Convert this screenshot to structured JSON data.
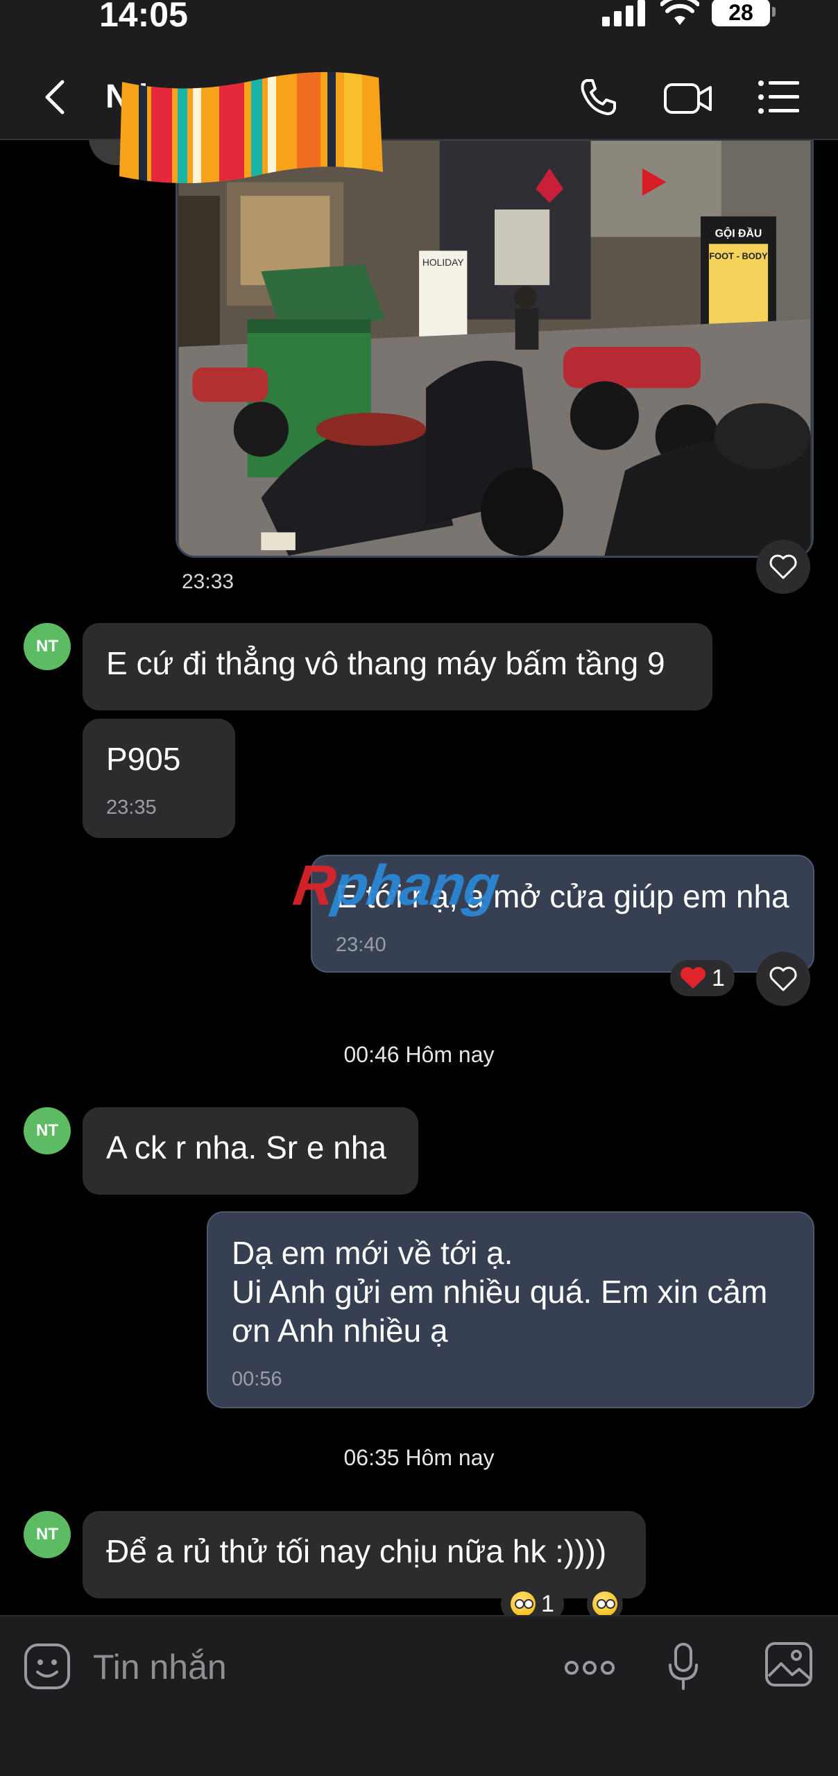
{
  "status_bar": {
    "time": "14:05",
    "battery": "28"
  },
  "header": {
    "contact_name": "N h"
  },
  "messages": {
    "photo_time": "23:33",
    "avatar_initials": "NT",
    "m1_text": "E cứ đi thẳng vô thang máy bấm tầng 9",
    "m2_text": "P905",
    "m2_time": "23:35",
    "m3_text": "E tới r ạ, a mở cửa giúp em nha",
    "m3_time": "23:40",
    "m3_reaction_count": "1",
    "divider1": "00:46 Hôm nay",
    "m4_text": "A ck r nha. Sr e nha",
    "m5_line1": "Dạ em mới về tới ạ.",
    "m5_line2": "Ui Anh gửi em nhiều quá. Em xin cảm",
    "m5_line3": "ơn Anh nhiều ạ",
    "m5_time": "00:56",
    "divider2": "06:35 Hôm nay",
    "m6_text": "Để a rủ thử tối nay chịu nữa hk :))))",
    "m6_reaction_count": "1"
  },
  "photo": {
    "sign_left": "HOLIDAY",
    "sign_right_top": "GỘI ĐẦU",
    "sign_right": "FOOT - BODY"
  },
  "watermark": {
    "part1": "R",
    "part2": "phang"
  },
  "composer": {
    "placeholder": "Tin nhắn"
  },
  "colors": {
    "incoming_bubble": "#2c2c2e",
    "outgoing_bubble": "#374052",
    "avatar": "#5dbb63"
  }
}
